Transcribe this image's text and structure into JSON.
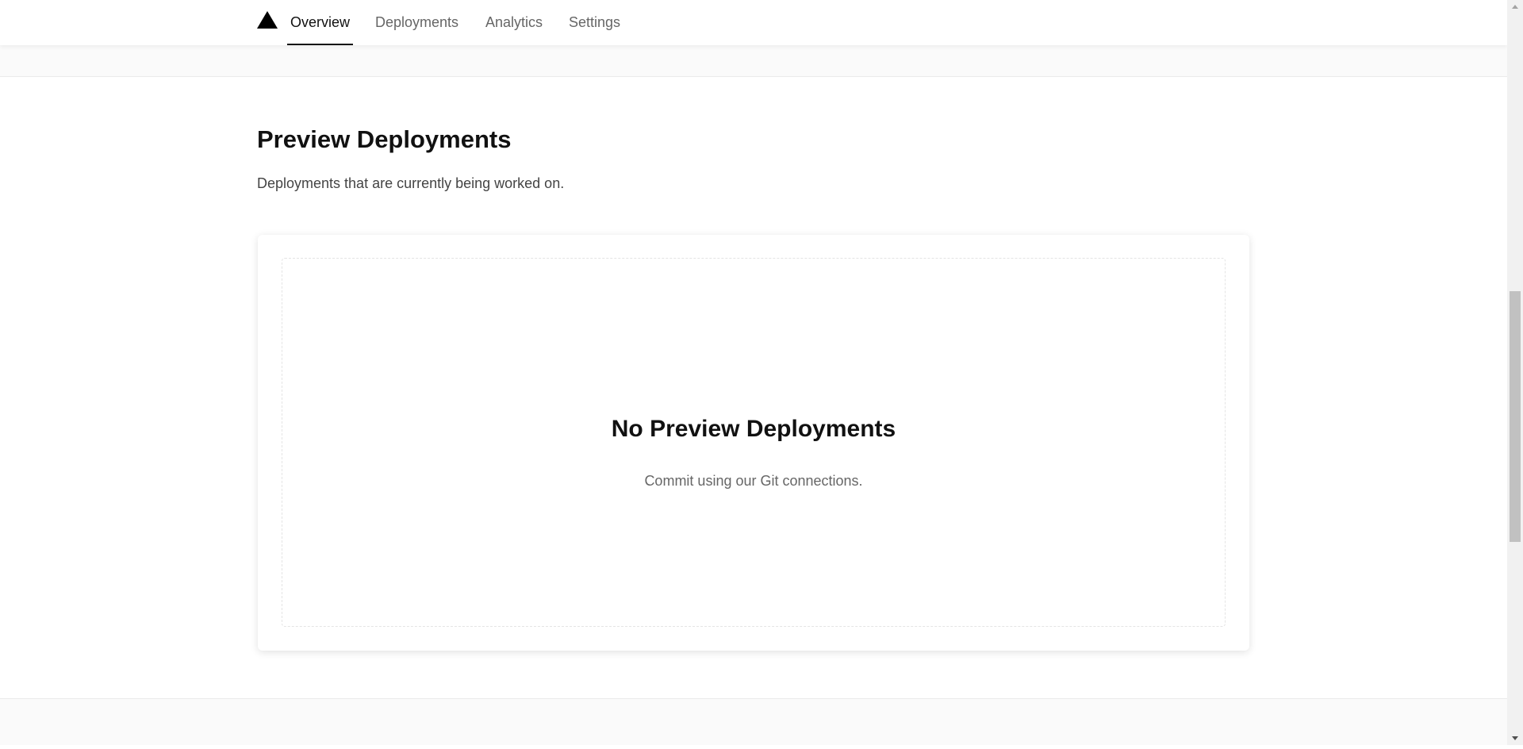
{
  "nav": {
    "logo_icon": "triangle-logo-icon",
    "tabs": [
      {
        "label": "Overview",
        "active": true
      },
      {
        "label": "Deployments",
        "active": false
      },
      {
        "label": "Analytics",
        "active": false
      },
      {
        "label": "Settings",
        "active": false
      }
    ]
  },
  "section": {
    "title": "Preview Deployments",
    "description": "Deployments that are currently being worked on."
  },
  "empty_state": {
    "title": "No Preview Deployments",
    "description": "Commit using our Git connections."
  },
  "scrollbar": {
    "up_icon": "scroll-up-arrow-icon",
    "down_icon": "scroll-down-arrow-icon"
  },
  "colors": {
    "text_primary": "#111111",
    "text_secondary": "#666666",
    "band_background": "#fafafa",
    "accent_underline": "#111111"
  }
}
